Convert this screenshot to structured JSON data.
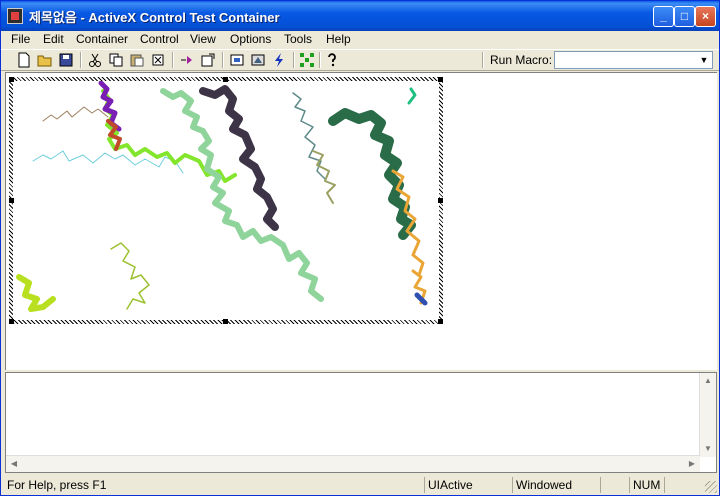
{
  "window": {
    "title": "제목없음 - ActiveX Control Test Container"
  },
  "titlebar_buttons": {
    "minimize": "_",
    "maximize": "□",
    "close": "×"
  },
  "menu": [
    {
      "label": "File"
    },
    {
      "label": "Edit"
    },
    {
      "label": "Container"
    },
    {
      "label": "Control"
    },
    {
      "label": "View"
    },
    {
      "label": "Options"
    },
    {
      "label": "Tools"
    },
    {
      "label": "Help"
    }
  ],
  "toolbar": {
    "icons": [
      "new-icon",
      "open-icon",
      "save-icon",
      "cut-icon",
      "copy-icon",
      "paste-icon",
      "delete-icon",
      "insert-control-icon",
      "properties-icon",
      "invoke-methods-icon",
      "ambient-icon",
      "events-icon",
      "design-mode-icon",
      "help-icon"
    ],
    "run_macro_label": "Run Macro:",
    "run_macro_value": ""
  },
  "status": {
    "help_text": "For Help, press F1",
    "panel_uiactive": "UIActive",
    "panel_windowed": "Windowed",
    "panel_num": "NUM"
  }
}
